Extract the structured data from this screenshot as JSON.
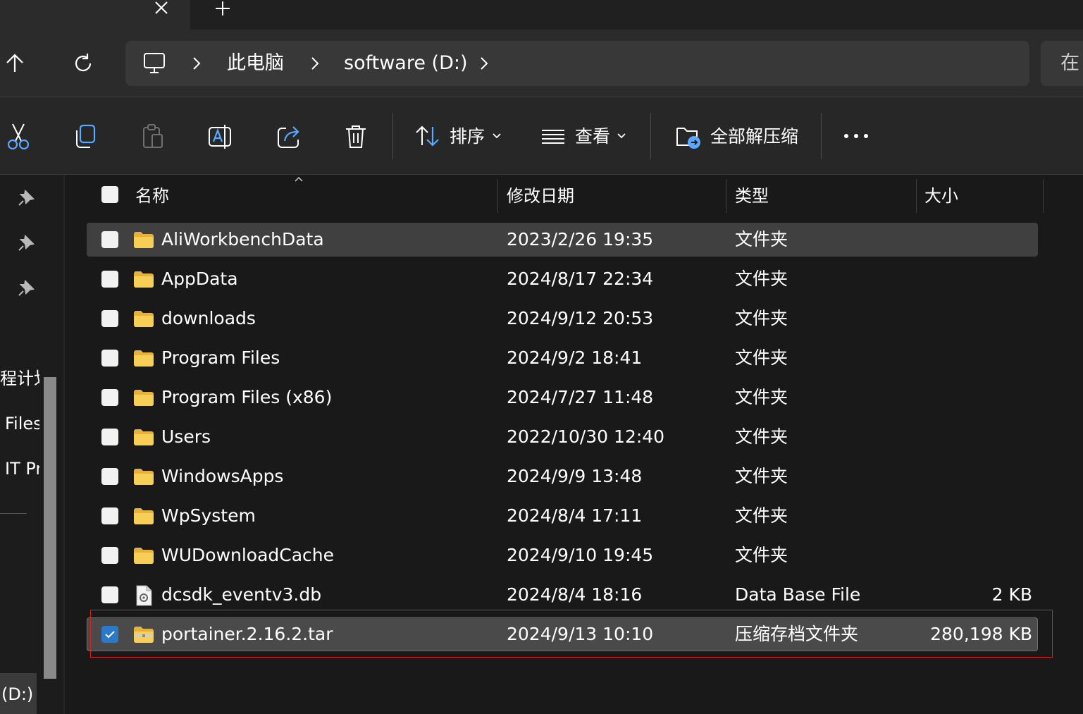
{
  "tab_strip": {
    "close_icon": "close-icon",
    "new_tab_icon": "plus-icon"
  },
  "nav": {
    "up_icon": "arrow-up-icon",
    "refresh_icon": "refresh-icon",
    "computer_icon": "monitor-icon",
    "breadcrumbs": [
      "此电脑",
      "software (D:)"
    ],
    "search_placeholder_visible": "在"
  },
  "toolbar": {
    "cut_icon": "scissors-icon",
    "copy_icon": "copy-icon",
    "paste_icon": "paste-icon",
    "rename_icon": "rename-icon",
    "share_icon": "share-icon",
    "delete_icon": "trash-icon",
    "sort_label": "排序",
    "view_label": "查看",
    "extract_all_label": "全部解压缩",
    "more_icon": "more-icon"
  },
  "sidebar": {
    "pinned_icons": [
      "pin-icon",
      "pin-icon",
      "pin-icon"
    ],
    "items": [
      "程计划",
      "Files",
      "IT Pr",
      "(D:)"
    ]
  },
  "columns": {
    "name": "名称",
    "modified": "修改日期",
    "type": "类型",
    "size": "大小"
  },
  "files": [
    {
      "name": "AliWorkbenchData",
      "modified": "2023/2/26 19:35",
      "type": "文件夹",
      "size": "",
      "kind": "folder",
      "state": "hover"
    },
    {
      "name": "AppData",
      "modified": "2024/8/17 22:34",
      "type": "文件夹",
      "size": "",
      "kind": "folder",
      "state": ""
    },
    {
      "name": "downloads",
      "modified": "2024/9/12 20:53",
      "type": "文件夹",
      "size": "",
      "kind": "folder",
      "state": ""
    },
    {
      "name": "Program Files",
      "modified": "2024/9/2 18:41",
      "type": "文件夹",
      "size": "",
      "kind": "folder",
      "state": ""
    },
    {
      "name": "Program Files (x86)",
      "modified": "2024/7/27 11:48",
      "type": "文件夹",
      "size": "",
      "kind": "folder",
      "state": ""
    },
    {
      "name": "Users",
      "modified": "2022/10/30 12:40",
      "type": "文件夹",
      "size": "",
      "kind": "folder",
      "state": ""
    },
    {
      "name": "WindowsApps",
      "modified": "2024/9/9 13:48",
      "type": "文件夹",
      "size": "",
      "kind": "folder",
      "state": ""
    },
    {
      "name": "WpSystem",
      "modified": "2024/8/4 17:11",
      "type": "文件夹",
      "size": "",
      "kind": "folder",
      "state": ""
    },
    {
      "name": "WUDownloadCache",
      "modified": "2024/9/10 19:45",
      "type": "文件夹",
      "size": "",
      "kind": "folder",
      "state": ""
    },
    {
      "name": "dcsdk_eventv3.db",
      "modified": "2024/8/4 18:16",
      "type": "Data Base File",
      "size": "2 KB",
      "kind": "file",
      "state": ""
    },
    {
      "name": "portainer.2.16.2.tar",
      "modified": "2024/9/13 10:10",
      "type": "压缩存档文件夹",
      "size": "280,198 KB",
      "kind": "zip",
      "state": "selected"
    }
  ],
  "colors": {
    "background": "#191919",
    "selection": "#4a4a4a",
    "checkbox_checked": "#2b79c9",
    "folder": "#f4c64a",
    "annotation": "#d92020"
  }
}
